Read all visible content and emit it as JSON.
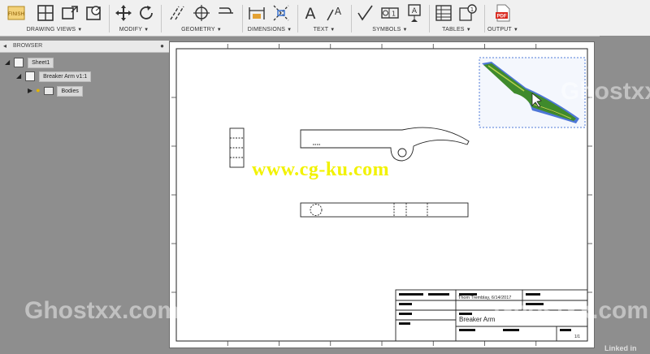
{
  "toolbar": {
    "groups": {
      "drawing_views": "DRAWING VIEWS",
      "modify": "MODIFY",
      "geometry": "GEOMETRY",
      "dimensions": "DIMENSIONS",
      "text": "TEXT",
      "symbols": "SYMBOLS",
      "tables": "TABLES",
      "output": "OUTPUT"
    },
    "finish_label": "FINISH",
    "pdf_label": "PDF"
  },
  "browser": {
    "title": "BROWSER",
    "items": [
      {
        "label": "Sheet1"
      },
      {
        "label": "Breaker Arm v1:1"
      },
      {
        "label": "Bodies"
      }
    ]
  },
  "title_block": {
    "author_date": "Thom Tremblay, 6/14/2017",
    "part_name": "Breaker Arm",
    "sheet": "1/1"
  },
  "watermarks": {
    "ghost": "Ghostxx.com",
    "site": "www.cg-ku.com",
    "corner": "Linked in"
  },
  "colors": {
    "toolbar_bg": "#f0f0f0",
    "canvas_bg": "#8e8e8e",
    "sheet_bg": "#ffffff",
    "selection_green": "#3f8a2c",
    "selection_blue": "#2f5fd0",
    "watermark_yellow": "#f2f200"
  }
}
